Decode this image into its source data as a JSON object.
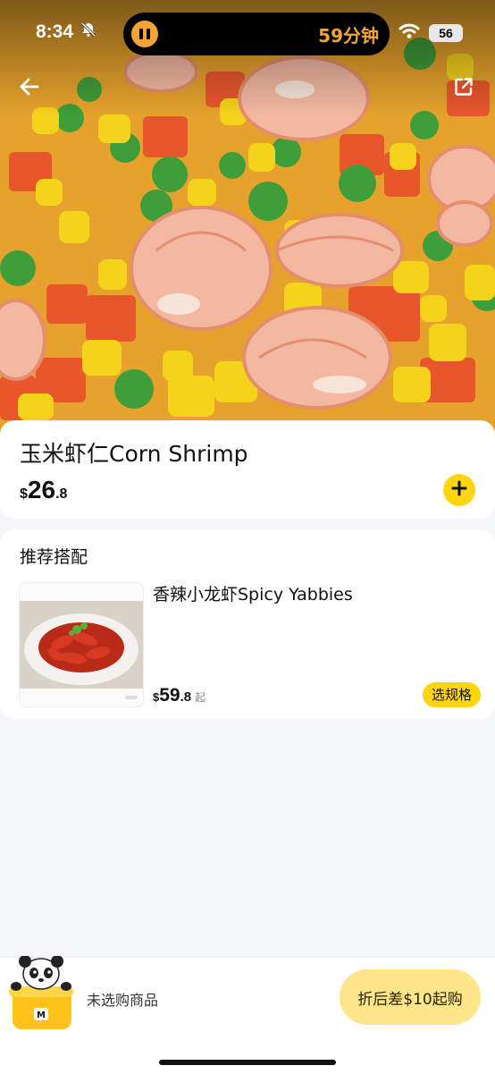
{
  "status_bar": {
    "time": "8:34",
    "island_text": "59分钟",
    "battery": "56",
    "bell_icon": "bell-slash-icon",
    "wifi_icon": "wifi-icon"
  },
  "header": {
    "back_icon": "arrow-left-icon",
    "share_icon": "share-icon"
  },
  "product": {
    "title": "玉米虾仁Corn Shrimp",
    "price_symbol": "$",
    "price_main": "26",
    "price_decimal": ".8",
    "add_icon": "plus-icon"
  },
  "recommend": {
    "heading": "推荐搭配",
    "items": [
      {
        "name": "香辣小龙虾Spicy Yabbies",
        "price_symbol": "$",
        "price_main": "59",
        "price_decimal": ".8",
        "price_from": "起",
        "spec_label": "选规格"
      }
    ]
  },
  "cart": {
    "empty_text": "未选购商品",
    "checkout_label": "折后差$10起购"
  },
  "colors": {
    "accent": "#ffd512",
    "checkout_bg": "#fde58a",
    "island_accent": "#f2a534",
    "page_bg": "#f5f6f8"
  }
}
